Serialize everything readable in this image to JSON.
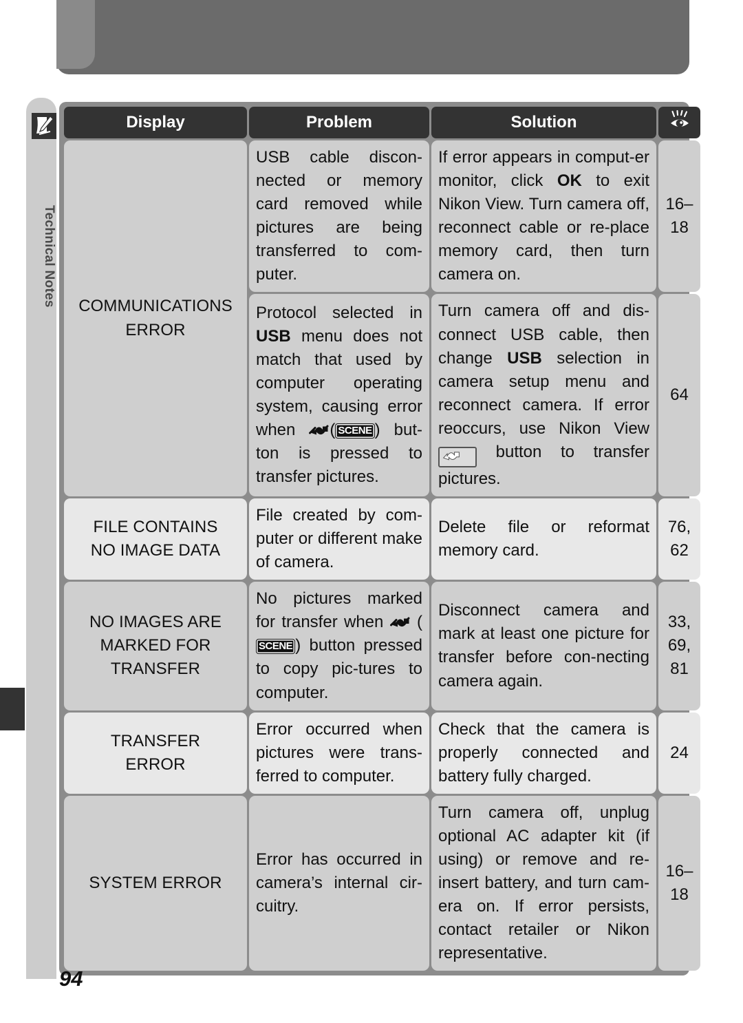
{
  "chapter": {
    "label": "Technical Notes",
    "icon": "note-pencil-icon"
  },
  "page_number": "94",
  "table": {
    "headers": {
      "display": "Display",
      "problem": "Problem",
      "solution": "Solution",
      "reference_icon": "eye-reference-icon"
    },
    "rows": [
      {
        "display": "COMMUNICATIONS ERROR",
        "display_line1": "COMMUNICATIONS",
        "display_line2": "ERROR",
        "sub_rows": [
          {
            "problem": "USB cable discon-nected or memory card removed while pictures are being transferred to com-puter.",
            "problem_plain": "USB cable disconnected or memory card removed while pictures are being transferred to computer.",
            "solution_plain": "If error appears in computer monitor, click OK to exit Nikon View. Turn camera off, reconnect cable or replace memory card, then turn camera on.",
            "reference": "16–18",
            "ref_line1": "16–",
            "ref_line2": "18"
          },
          {
            "problem_plain": "Protocol selected in USB menu does not match that used by computer operating system, causing error when (SCENE) button is pressed to transfer pictures.",
            "solution_plain": "Turn camera off and disconnect USB cable, then change USB selection in camera setup menu and reconnect camera. If error reoccurs, use Nikon View button to transfer pictures.",
            "reference": "64"
          }
        ]
      },
      {
        "display_line1": "FILE CONTAINS",
        "display_line2": "NO IMAGE DATA",
        "problem_plain": "File created by computer or different make of camera.",
        "solution_plain": "Delete file or reformat memory card.",
        "reference": "76, 62",
        "ref_line1": "76,",
        "ref_line2": "62"
      },
      {
        "display_line1": "NO IMAGES ARE",
        "display_line2": "MARKED FOR",
        "display_line3": "TRANSFER",
        "problem_plain": "No pictures marked for transfer when (SCENE) button pressed to copy pictures to computer.",
        "solution_plain": "Disconnect camera and mark at least one picture for transfer before connecting camera again.",
        "reference": "33, 69, 81",
        "ref_line1": "33,",
        "ref_line2": "69,",
        "ref_line3": "81"
      },
      {
        "display_line1": "TRANSFER",
        "display_line2": "ERROR",
        "problem_plain": "Error occurred when pictures were transferred to computer.",
        "solution_plain": "Check that the camera is properly connected and battery fully charged.",
        "reference": "24"
      },
      {
        "display_line1": "SYSTEM ERROR",
        "problem_plain": "Error has occurred in camera’s internal circuitry.",
        "solution_plain": "Turn camera off, unplug optional AC adapter kit (if using) or remove and re-insert battery, and turn camera on. If error persists, contact retailer or Nikon representative.",
        "reference": "16–18",
        "ref_line1": "16–",
        "ref_line2": "18"
      }
    ],
    "text_fragments": {
      "r1_problem": {
        "a": "USB cable discon-nected or memory card removed while pictures are being transferred to com-puter."
      },
      "r1_solution": {
        "a": "If error appears in comput-er monitor, click ",
        "ok": "OK",
        "b": " to exit Nikon View.  Turn camera off, reconnect cable or re-place memory card, then turn camera on."
      },
      "r2_problem": {
        "a": "Protocol selected in ",
        "usb": "USB",
        "b": " menu does not match that used by computer operating system, causing error when ",
        "scene": "SCENE",
        "c": ") but-ton is pressed to transfer pictures."
      },
      "r2_solution": {
        "a": "Turn camera off and dis-connect USB cable, then change ",
        "usb": "USB",
        "b": " selection in camera setup menu and reconnect camera.  If error reoccurs, use Nikon View ",
        "c": " button to transfer pictures."
      },
      "r3_problem": {
        "a": "File created by com-puter or different make of camera."
      },
      "r3_solution": {
        "a": "Delete file or reformat memory card."
      },
      "r4_problem": {
        "a": "No pictures marked for transfer when ",
        "scene": "SCENE",
        "b": ") button pressed to copy pic-tures to computer."
      },
      "r4_solution": {
        "a": "Disconnect camera and mark at least one picture for transfer before con-necting camera again."
      },
      "r5_problem": {
        "a": "Error occurred when pictures were trans-ferred to computer."
      },
      "r5_solution": {
        "a": "Check that the camera is properly connected and battery fully charged."
      },
      "r6_problem": {
        "a": "Error has occurred in camera’s internal cir-cuitry."
      },
      "r6_solution": {
        "a": "Turn camera off, unplug optional AC adapter kit (if using) or remove and re-insert battery, and turn cam-era on.  If error persists, contact retailer or Nikon representative."
      }
    }
  },
  "colors": {
    "header_band": "#6b6b6b",
    "header_band_left": "#8a8a8a",
    "tab_gray": "#cccccc",
    "table_grid": "#8c8c8c",
    "th_dark": "#333333",
    "row_shade_dark": "#cfcfcf",
    "row_shade_light": "#e8e8e8",
    "text": "#111111"
  }
}
